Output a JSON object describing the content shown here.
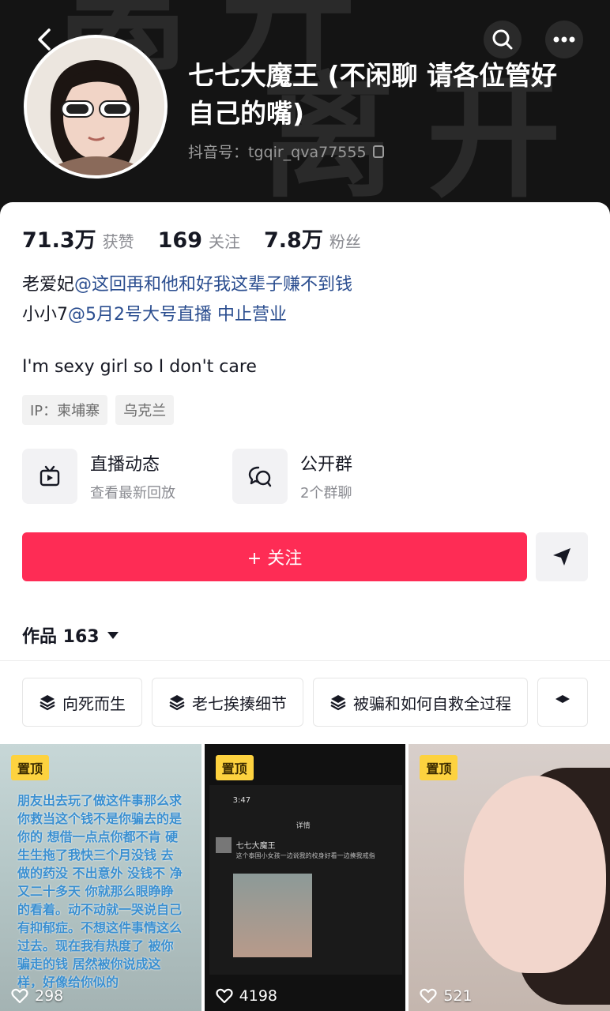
{
  "header": {
    "nickname": "七七大魔王 (不闲聊 请各位管好自己的嘴)",
    "douyin_id": "抖音号：tgqir_qva77555",
    "bg_text": [
      "离开",
      "离开"
    ]
  },
  "stats": [
    {
      "num": "71.3万",
      "label": "获赞"
    },
    {
      "num": "169",
      "label": "关注"
    },
    {
      "num": "7.8万",
      "label": "粉丝"
    }
  ],
  "bio": {
    "line1_prefix": "老爱妃",
    "line1_mention": "@这回再和他和好我这辈子赚不到钱",
    "line2_prefix": "小小7",
    "line2_mention": "@5月2号大号直播 中止营业",
    "english": "I'm sexy girl so I don't care"
  },
  "tags": [
    "IP：柬埔寨",
    "乌克兰"
  ],
  "features": [
    {
      "title": "直播动态",
      "sub": "查看最新回放",
      "icon": "live-tv-icon"
    },
    {
      "title": "公开群",
      "sub": "2个群聊",
      "icon": "group-chat-icon"
    }
  ],
  "follow_label": "+ 关注",
  "works_label": "作品 163",
  "collections": [
    "向死而生",
    "老七挨揍细节",
    "被骗和如何自救全过程"
  ],
  "videos": [
    {
      "pin": "置顶",
      "likes": "298",
      "overlay": "朋友出去玩了做这件事那么求你救当这个钱不是你骗去的是你的 想借一点点你都不肯 硬生生拖了我快三个月没钱 去做的药没 不出意外 没钱不 净 又二十多天 你就那么眼睁睁的看着。动不动就一哭说自己有抑郁症。不想这件事情这么过去。现在我有热度了 被你骗走的钱 居然被你说成这样，好像给你似的"
    },
    {
      "pin": "置顶",
      "likes": "4198",
      "screen_time": "3:47",
      "screen_title": "详情",
      "screen_name": "七七大魔王",
      "screen_text": "这个泰国小女孩一边说我的校身好看一边揍我戒指"
    },
    {
      "pin": "置顶",
      "likes": "521"
    }
  ],
  "colors": {
    "accent": "#fe2c55",
    "pin": "#fdd23f",
    "mention": "#2a4d8f"
  }
}
